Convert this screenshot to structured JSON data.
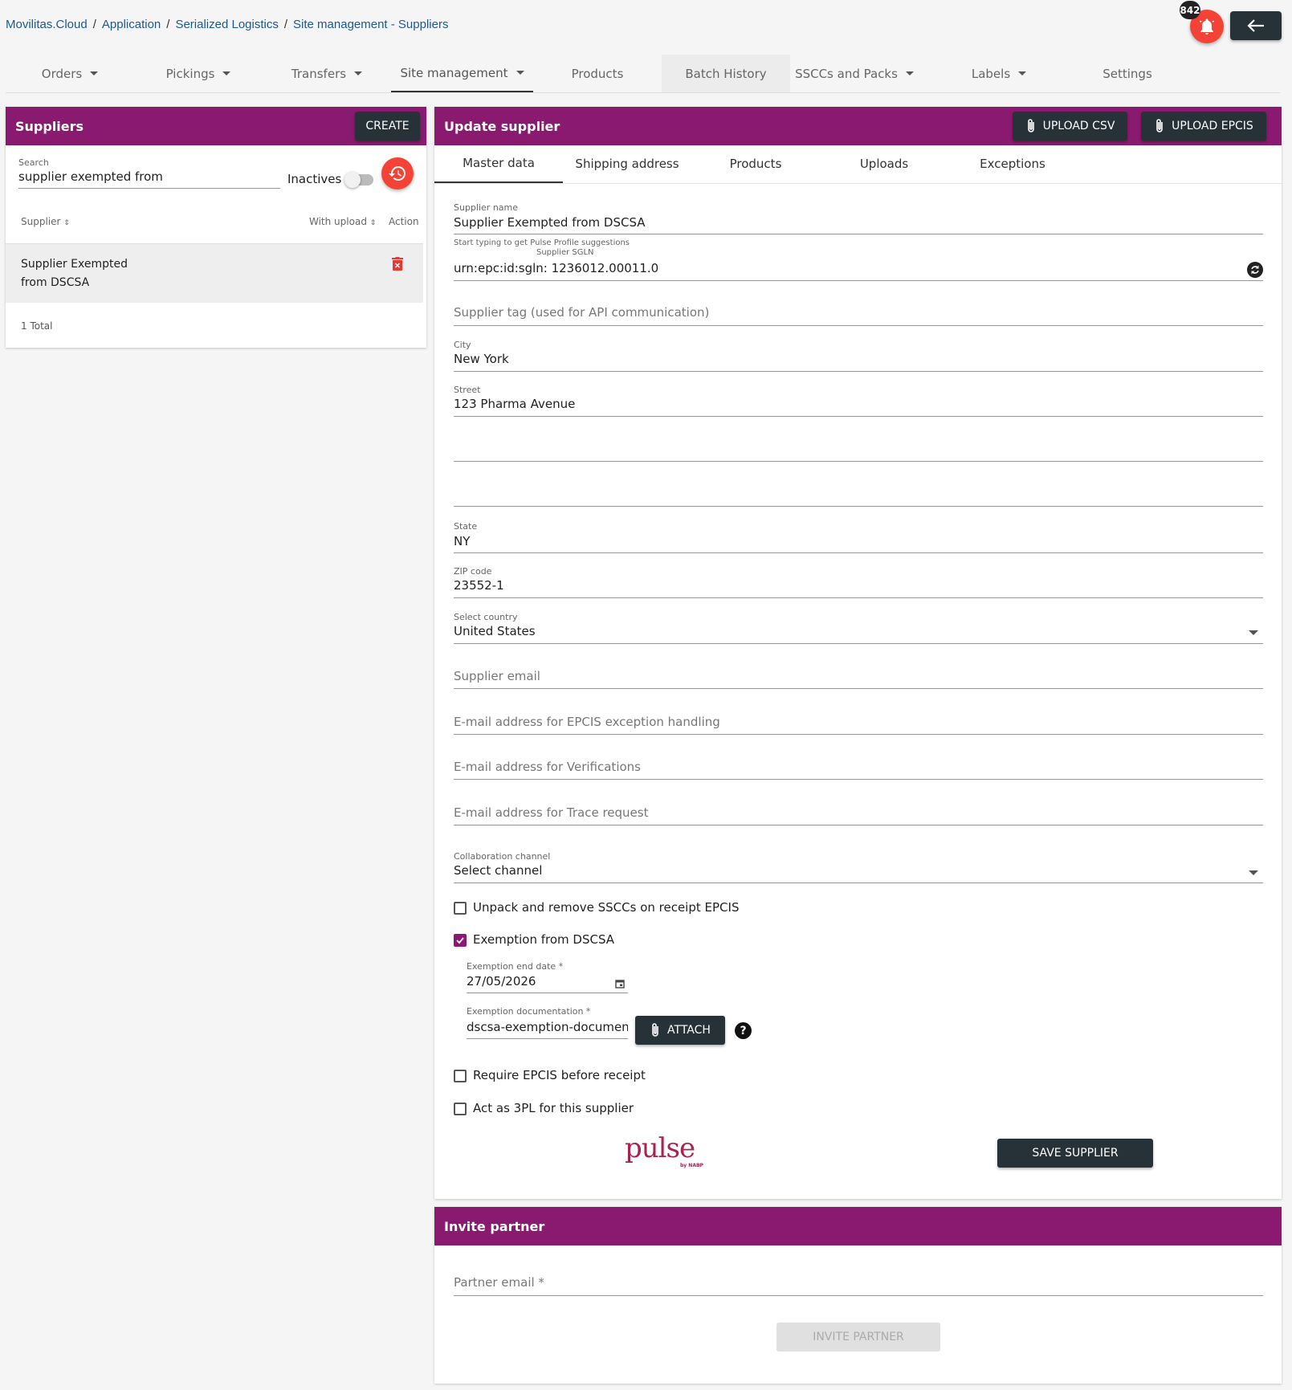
{
  "breadcrumb": [
    "Movilitas.Cloud",
    "Application",
    "Serialized Logistics",
    "Site management - Suppliers"
  ],
  "notifications": {
    "count": "842"
  },
  "nav": {
    "orders": "Orders",
    "pickings": "Pickings",
    "transfers": "Transfers",
    "site_management": "Site management",
    "products": "Products",
    "batch_history": "Batch History",
    "ssccs": "SSCCs and Packs",
    "labels": "Labels",
    "settings": "Settings"
  },
  "suppliers_panel": {
    "title": "Suppliers",
    "create": "CREATE",
    "search_label": "Search",
    "search_value": "supplier exempted from",
    "inactives": "Inactives",
    "col_supplier": "Supplier",
    "col_upload": "With upload",
    "col_action": "Action",
    "row_name": "Supplier Exempted from DSCSA",
    "total": "1 Total"
  },
  "update": {
    "title": "Update supplier",
    "upload_csv": "UPLOAD CSV",
    "upload_epcis": "UPLOAD EPCIS",
    "tabs": [
      "Master data",
      "Shipping address",
      "Products",
      "Uploads",
      "Exceptions"
    ],
    "supplier_name_label": "Supplier name",
    "supplier_name": "Supplier Exempted from DSCSA",
    "pulse_hint": "Start typing to get Pulse Profile suggestions",
    "sgln_label": "Supplier SGLN",
    "sgln": "urn:epc:id:sgln: 1236012.00011.0",
    "tag_ph": "Supplier tag (used for API communication)",
    "city_label": "City",
    "city": "New York",
    "street_label": "Street",
    "street": "123 Pharma Avenue",
    "state_label": "State",
    "state": "NY",
    "zip_label": "ZIP code",
    "zip": "23552-1",
    "country_label": "Select country",
    "country": "United States",
    "email_ph": "Supplier email",
    "epcis_email_ph": "E-mail address for EPCIS exception handling",
    "verif_email_ph": "E-mail address for Verifications",
    "trace_email_ph": "E-mail address for Trace request",
    "channel_label": "Collaboration channel",
    "channel": "Select channel",
    "unpack": "Unpack and remove SSCCs on receipt EPCIS",
    "exemption": "Exemption from DSCSA",
    "exemption_date_label": "Exemption end date *",
    "exemption_date": "27/05/2026",
    "exemption_doc_label": "Exemption documentation *",
    "exemption_doc": "dscsa-exemption-document-ex",
    "attach": "ATTACH",
    "require_epcis": "Require EPCIS before receipt",
    "act_3pl": "Act as 3PL for this supplier",
    "pulse_logo": "pulse",
    "pulse_sub": "by NABP",
    "save": "SAVE SUPPLIER"
  },
  "invite": {
    "title": "Invite partner",
    "email_ph": "Partner email *",
    "button": "INVITE PARTNER"
  },
  "colors": {
    "brand": "#8a1a6f",
    "dark": "#263238",
    "alert": "#f44336"
  }
}
